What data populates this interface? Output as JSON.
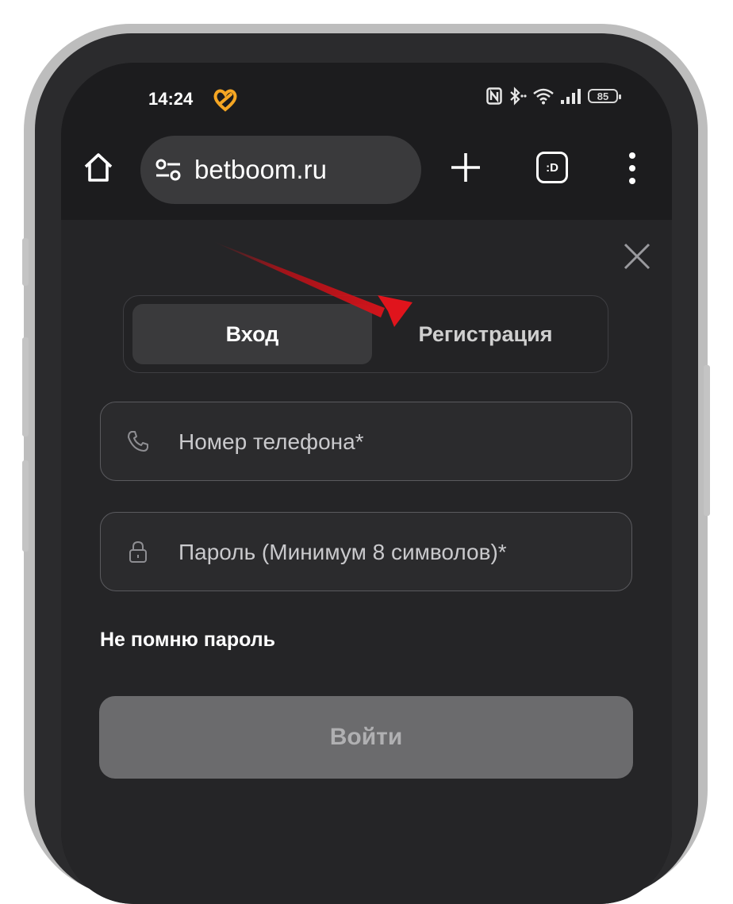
{
  "status_bar": {
    "time": "14:24",
    "battery": "85"
  },
  "browser": {
    "url": "betboom.ru",
    "tabs_icon_label": ":D"
  },
  "auth": {
    "tab_login": "Вход",
    "tab_register": "Регистрация",
    "phone_placeholder": "Номер телефона*",
    "password_placeholder": "Пароль (Минимум 8 символов)*",
    "forgot_password": "Не помню пароль",
    "submit": "Войти"
  },
  "colors": {
    "annotation_arrow": "#e0141c",
    "heart_icon": "#f5a623",
    "screen_bg": "#1f1f21"
  }
}
